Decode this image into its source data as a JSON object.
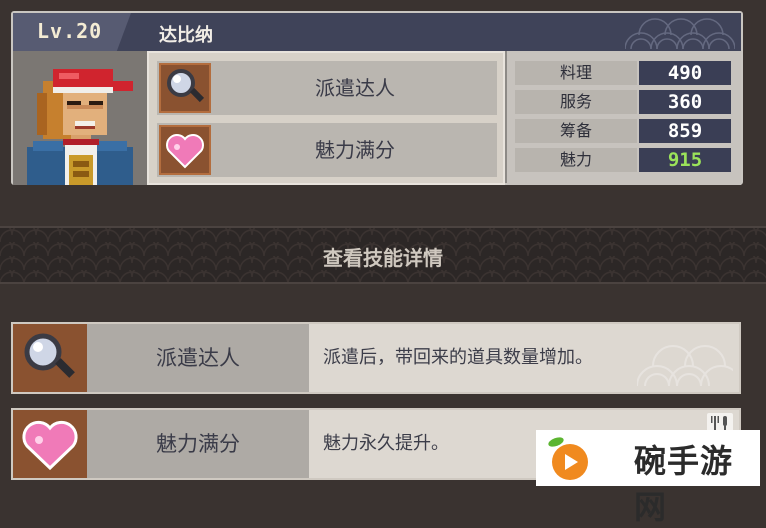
{
  "character": {
    "level": "Lv.20",
    "name": "达比纳",
    "portrait_icon": "pixel-character-portrait"
  },
  "skills": [
    {
      "name": "派遣达人",
      "icon": "magnifier-icon"
    },
    {
      "name": "魅力满分",
      "icon": "heart-icon"
    }
  ],
  "stats": [
    {
      "label": "料理",
      "value": "490",
      "value_color": "#ffffff"
    },
    {
      "label": "服务",
      "value": "360",
      "value_color": "#ffffff"
    },
    {
      "label": "筹备",
      "value": "859",
      "value_color": "#ffffff"
    },
    {
      "label": "魅力",
      "value": "915",
      "value_color": "#9be35a"
    }
  ],
  "section": {
    "title": "查看技能详情"
  },
  "details": [
    {
      "name": "派遣达人",
      "description": "派遣后，带回来的道具数量增加。",
      "icon": "magnifier-icon"
    },
    {
      "name": "魅力满分",
      "description": "魅力永久提升。",
      "icon": "heart-icon",
      "tag_icon": "fork-knife-icon"
    }
  ],
  "watermark": {
    "text": "碗手游网",
    "logo_icon": "play-logo-icon"
  },
  "colors": {
    "accent_green": "#9be35a",
    "header_navy": "#3f4359",
    "icon_brown": "#8a5230"
  }
}
